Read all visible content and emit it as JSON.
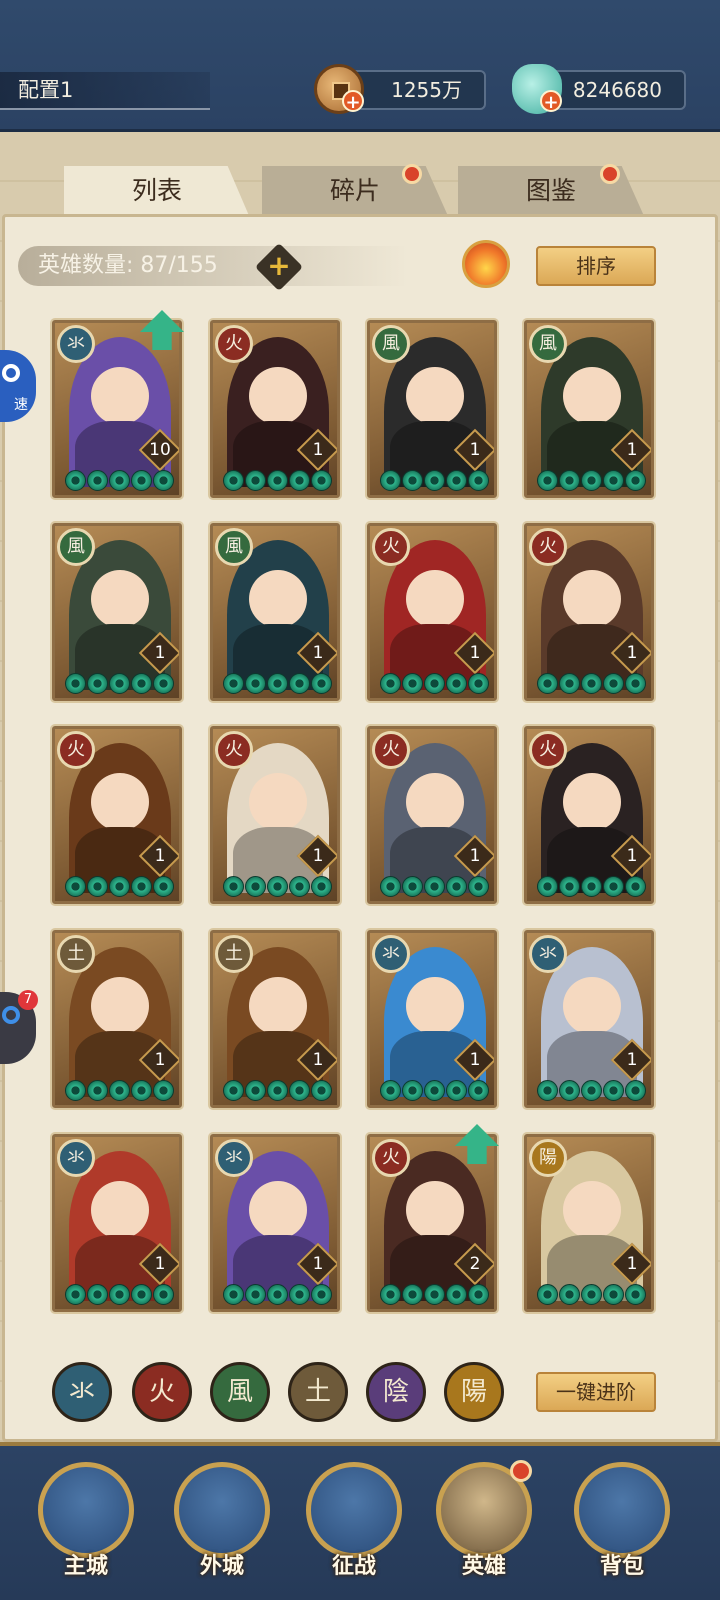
{
  "header": {
    "config_label": "配置1",
    "coins": "1255万",
    "jade": "8246680"
  },
  "tabs": [
    {
      "label": "列表",
      "active": true
    },
    {
      "label": "碎片",
      "active": false,
      "dot": true
    },
    {
      "label": "图鉴",
      "active": false,
      "dot": true
    }
  ],
  "hero_count": "英雄数量: 87/155",
  "sort_label": "排序",
  "advance_label": "一键进阶",
  "side_buttons": {
    "speed_label": "速",
    "badge": "7"
  },
  "element_colors": {
    "水": "#2f5f74",
    "火": "#8b2c22",
    "風": "#356a3e",
    "土": "#6e5a3a",
    "陰": "#5a3d7a",
    "陽": "#a8771d"
  },
  "element_glyphs": {
    "水": "氺",
    "火": "火",
    "風": "風",
    "土": "土",
    "陰": "陰",
    "陽": "陽"
  },
  "heroes": [
    {
      "element": "水",
      "level": "10",
      "portrait_color": "#6a4fa8",
      "up": true
    },
    {
      "element": "火",
      "level": "1",
      "portrait_color": "#3a2020",
      "up": false
    },
    {
      "element": "風",
      "level": "1",
      "portrait_color": "#2b2b2b",
      "up": false
    },
    {
      "element": "風",
      "level": "1",
      "portrait_color": "#2e3a2a",
      "up": false
    },
    {
      "element": "風",
      "level": "1",
      "portrait_color": "#3a4a3a",
      "up": false
    },
    {
      "element": "風",
      "level": "1",
      "portrait_color": "#22404a",
      "up": false
    },
    {
      "element": "火",
      "level": "1",
      "portrait_color": "#a02624",
      "up": false
    },
    {
      "element": "火",
      "level": "1",
      "portrait_color": "#5a3a2a",
      "up": false
    },
    {
      "element": "火",
      "level": "1",
      "portrait_color": "#6a3a1a",
      "up": false
    },
    {
      "element": "火",
      "level": "1",
      "portrait_color": "#e4d8c4",
      "up": false
    },
    {
      "element": "火",
      "level": "1",
      "portrait_color": "#5a6272",
      "up": false
    },
    {
      "element": "火",
      "level": "1",
      "portrait_color": "#2a2222",
      "up": false
    },
    {
      "element": "土",
      "level": "1",
      "portrait_color": "#7a4a22",
      "up": false
    },
    {
      "element": "土",
      "level": "1",
      "portrait_color": "#7a4a22",
      "up": false
    },
    {
      "element": "水",
      "level": "1",
      "portrait_color": "#3a8ad0",
      "up": false
    },
    {
      "element": "水",
      "level": "1",
      "portrait_color": "#b8c0d0",
      "up": false
    },
    {
      "element": "水",
      "level": "1",
      "portrait_color": "#b03a2a",
      "up": false
    },
    {
      "element": "水",
      "level": "1",
      "portrait_color": "#6a4fa8",
      "up": false
    },
    {
      "element": "火",
      "level": "2",
      "portrait_color": "#4a2a22",
      "up": true
    },
    {
      "element": "陽",
      "level": "1",
      "portrait_color": "#d8c8a0",
      "up": false
    }
  ],
  "filters": [
    "水",
    "火",
    "風",
    "土",
    "陰",
    "陽"
  ],
  "nav": [
    {
      "label": "主城",
      "icon": "palace-icon"
    },
    {
      "label": "外城",
      "icon": "city-gate-icon"
    },
    {
      "label": "征战",
      "icon": "horn-icon"
    },
    {
      "label": "英雄",
      "icon": "hero-portrait-icon",
      "active": true
    },
    {
      "label": "背包",
      "icon": "bag-icon"
    }
  ]
}
